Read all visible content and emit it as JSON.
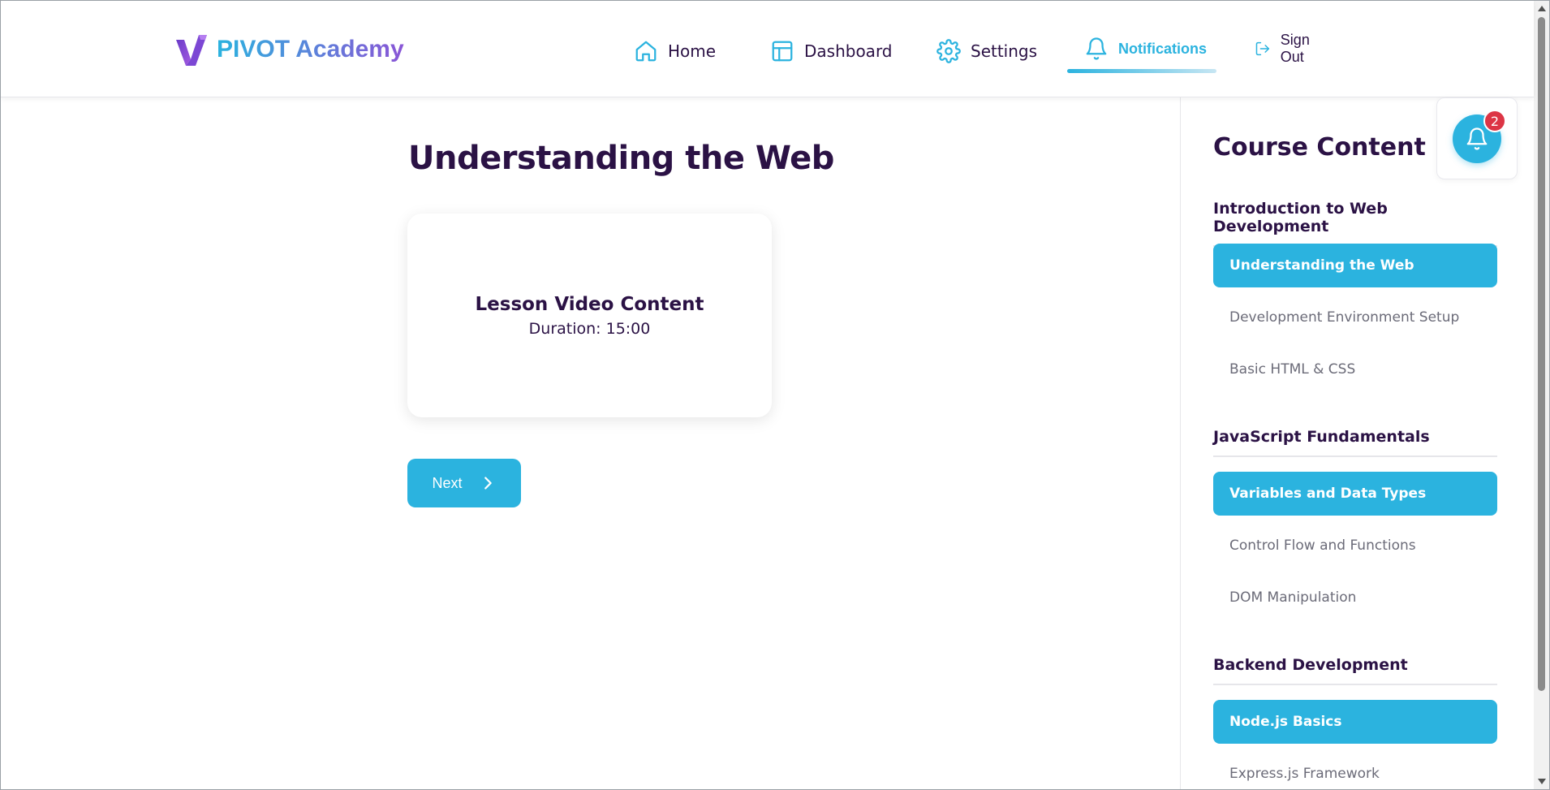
{
  "header": {
    "brand_name": "PIVOT Academy",
    "nav": [
      {
        "label": "Home",
        "icon": "home-icon"
      },
      {
        "label": "Dashboard",
        "icon": "dashboard-icon"
      },
      {
        "label": "Settings",
        "icon": "gear-icon"
      },
      {
        "label": "Notifications",
        "icon": "bell-icon",
        "active": true
      },
      {
        "label": "Sign Out",
        "icon": "sign-out-icon"
      }
    ]
  },
  "main": {
    "title": "Understanding the Web",
    "video": {
      "title": "Lesson Video Content",
      "duration": "Duration: 15:00"
    },
    "next_label": "Next"
  },
  "sidebar": {
    "title": "Course Content",
    "sections": [
      {
        "heading": "Introduction to Web Development",
        "lessons": [
          {
            "label": "Understanding the Web",
            "active": true
          },
          {
            "label": "Development Environment Setup"
          },
          {
            "label": "Basic HTML & CSS"
          }
        ]
      },
      {
        "heading": "JavaScript Fundamentals",
        "lessons": [
          {
            "label": "Variables and Data Types",
            "active": true
          },
          {
            "label": "Control Flow and Functions"
          },
          {
            "label": "DOM Manipulation"
          }
        ]
      },
      {
        "heading": "Backend Development",
        "lessons": [
          {
            "label": "Node.js Basics",
            "active": true
          },
          {
            "label": "Express.js Framework"
          }
        ]
      }
    ]
  },
  "notifications": {
    "badge_count": "2"
  },
  "colors": {
    "accent": "#2bb3df",
    "text": "#2b1245",
    "muted": "#6b6b78",
    "badge": "#dc3545",
    "brand_gradient_end": "#8a55d6"
  }
}
